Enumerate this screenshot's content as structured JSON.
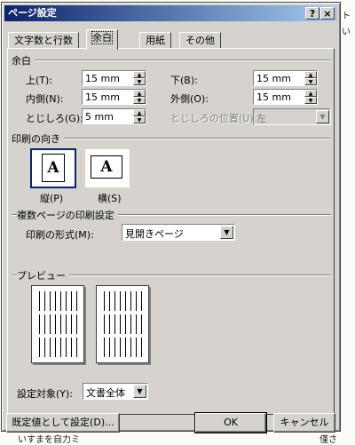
{
  "dialog": {
    "title": "ページ設定",
    "help_glyph": "?",
    "close_glyph": "×"
  },
  "tabs": [
    {
      "label": "文字数と行数"
    },
    {
      "label": "余白"
    },
    {
      "label": "用紙"
    },
    {
      "label": "その他"
    }
  ],
  "margins": {
    "section": "余白",
    "top_label": "上(T):",
    "top_value": "15 mm",
    "bottom_label": "下(B):",
    "bottom_value": "15 mm",
    "inner_label": "内側(N):",
    "inner_value": "15 mm",
    "outer_label": "外側(O):",
    "outer_value": "15 mm",
    "gutter_label": "とじしろ(G):",
    "gutter_value": "5 mm",
    "gutter_pos_label": "とじしろの位置(U):",
    "gutter_pos_value": "左"
  },
  "orientation": {
    "section": "印刷の向き",
    "icon_glyph": "A",
    "portrait_label": "縦(P)",
    "landscape_label": "横(S)",
    "selected": "portrait"
  },
  "multipage": {
    "section": "複数ページの印刷設定",
    "format_label": "印刷の形式(M):",
    "format_value": "見開きページ"
  },
  "preview": {
    "section": "プレビュー"
  },
  "apply": {
    "label": "設定対象(Y):",
    "value": "文書全体"
  },
  "buttons": {
    "default": "既定値として設定(D)...",
    "ok": "OK",
    "cancel": "キャンセル"
  },
  "background": {
    "right_column": "ト\nい\n\n\n\n\n\n\n\n\n\n\n\n\n\n\n\n\n\n\n\n\n\n\n\n\n",
    "bottom_text": "いすまを自力ミ",
    "bottom_right": "僅さ"
  }
}
